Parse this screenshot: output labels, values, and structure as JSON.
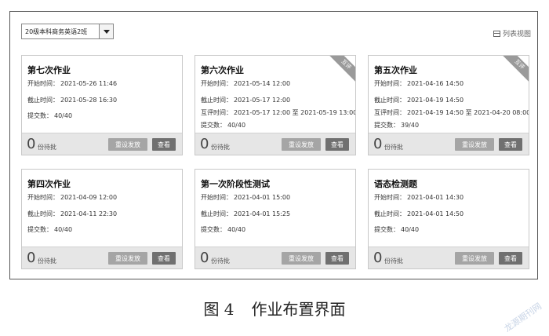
{
  "toolbar": {
    "class_select_value": "20级本科商务英语2班",
    "list_view_label": "列表视图"
  },
  "labels": {
    "start": "开始时间：",
    "deadline": "截止时间：",
    "peer_review": "互评时间：",
    "submitted": "提交数：",
    "pending_suffix": "份待批",
    "redo_button": "重设发放",
    "view_button": "查看",
    "peer_badge": "互评"
  },
  "cards": [
    {
      "title": "第七次作业",
      "start": "2021-05-26 11:46",
      "deadline": "2021-05-28 16:30",
      "submitted": "40/40",
      "pending": "0"
    },
    {
      "title": "第六次作业",
      "start": "2021-05-14 12:00",
      "deadline": "2021-05-17 12:00",
      "peer_review": "2021-05-17 12:00 至 2021-05-19 13:00",
      "submitted": "40/40",
      "pending": "0"
    },
    {
      "title": "第五次作业",
      "start": "2021-04-16 14:50",
      "deadline": "2021-04-19 14:50",
      "peer_review": "2021-04-19 14:50 至 2021-04-20 08:00",
      "submitted": "39/40",
      "pending": "0"
    },
    {
      "title": "第四次作业",
      "start": "2021-04-09 12:00",
      "deadline": "2021-04-11 22:30",
      "submitted": "40/40",
      "pending": "0"
    },
    {
      "title": "第一次阶段性测试",
      "start": "2021-04-01 15:00",
      "deadline": "2021-04-01 15:25",
      "submitted": "40/40",
      "pending": "0"
    },
    {
      "title": "语态检测题",
      "start": "2021-04-01 14:30",
      "deadline": "2021-04-01 14:50",
      "submitted": "40/40",
      "pending": "0"
    }
  ],
  "caption": {
    "figure_label": "图 4",
    "text": "作业布置界面"
  },
  "watermark": "龙源期刊网"
}
